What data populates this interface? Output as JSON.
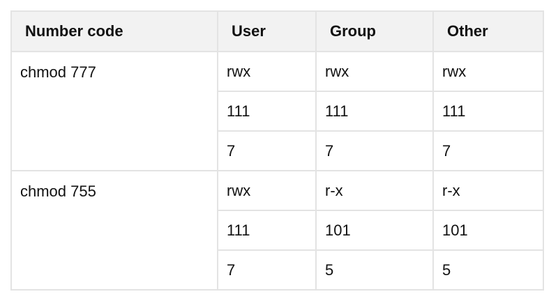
{
  "table": {
    "headers": [
      "Number code",
      "User",
      "Group",
      "Other"
    ],
    "groups": [
      {
        "code": "chmod 777",
        "rows": [
          [
            "rwx",
            "rwx",
            "rwx"
          ],
          [
            "111",
            "111",
            "111"
          ],
          [
            "7",
            "7",
            "7"
          ]
        ]
      },
      {
        "code": "chmod 755",
        "rows": [
          [
            "rwx",
            "r-x",
            "r-x"
          ],
          [
            "111",
            "101",
            "101"
          ],
          [
            "7",
            "5",
            "5"
          ]
        ]
      }
    ]
  }
}
